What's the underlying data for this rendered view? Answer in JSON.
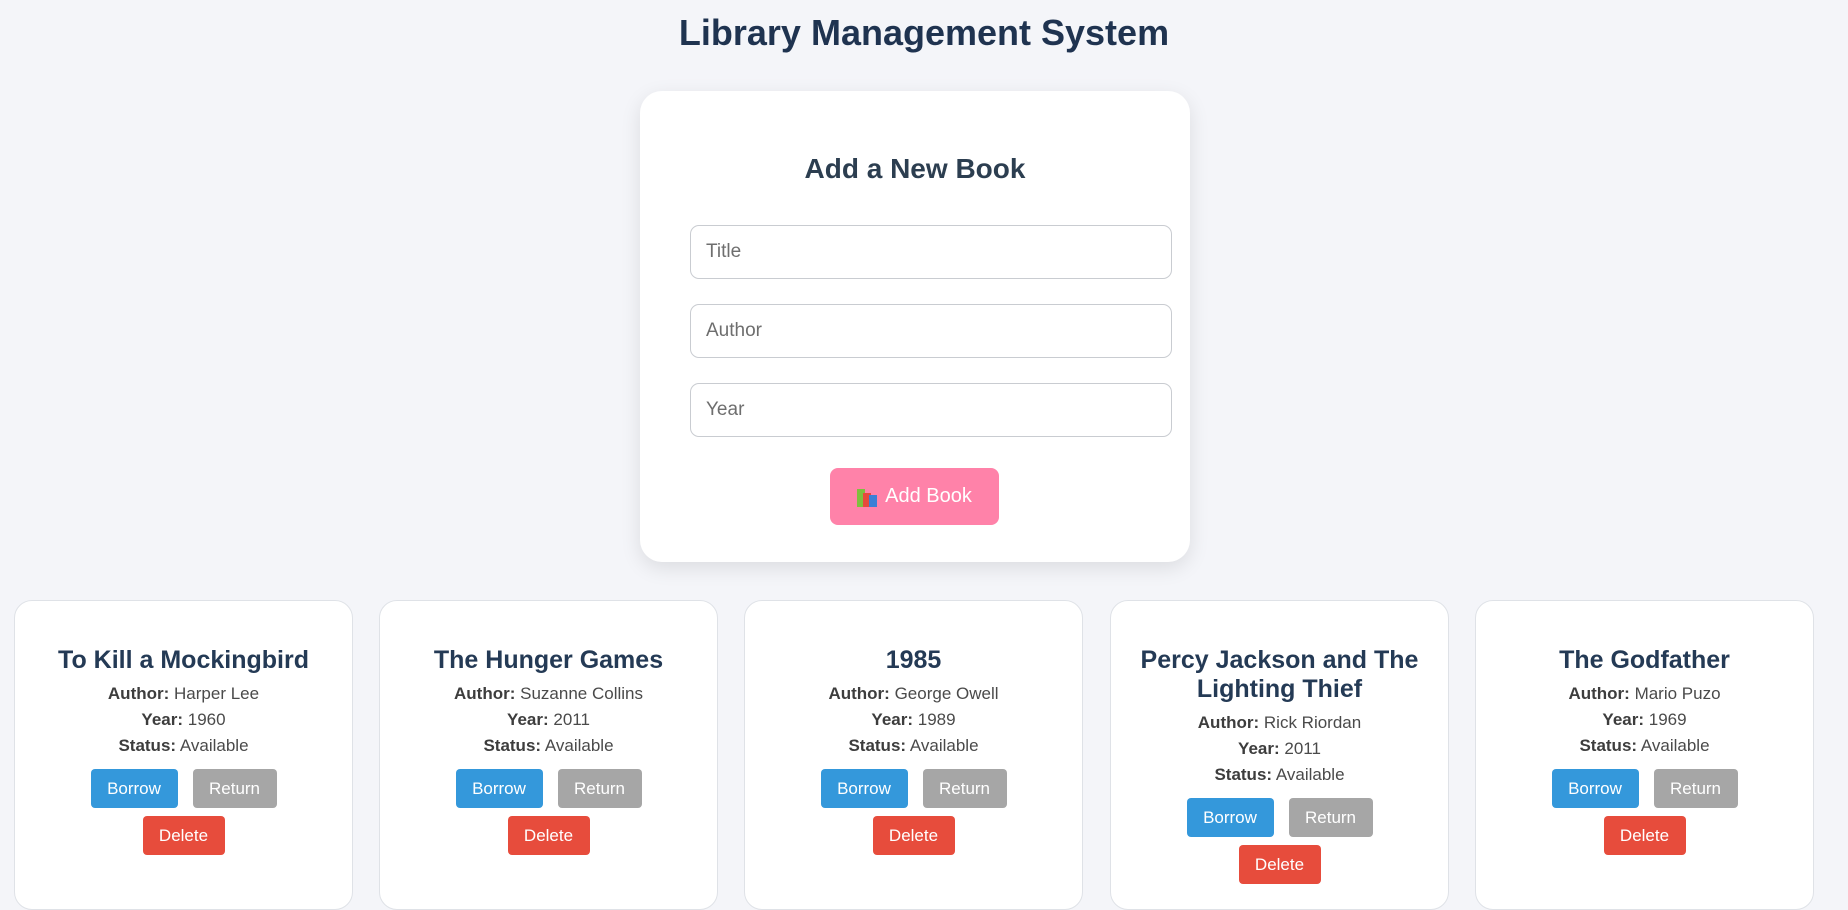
{
  "page": {
    "title": "Library Management System"
  },
  "form": {
    "title": "Add a New Book",
    "fields": {
      "title_placeholder": "Title",
      "author_placeholder": "Author",
      "year_placeholder": "Year"
    },
    "add_button": {
      "icon": "books-icon",
      "label": "Add Book"
    }
  },
  "labels": {
    "author": "Author:",
    "year": "Year:",
    "status": "Status:",
    "borrow": "Borrow",
    "return": "Return",
    "delete": "Delete"
  },
  "books": [
    {
      "title": "To Kill a Mockingbird",
      "author": "Harper Lee",
      "year": "1960",
      "status": "Available"
    },
    {
      "title": "The Hunger Games",
      "author": "Suzanne Collins",
      "year": "2011",
      "status": "Available"
    },
    {
      "title": "1985",
      "author": "George Owell",
      "year": "1989",
      "status": "Available"
    },
    {
      "title": "Percy Jackson and The Lighting Thief",
      "author": "Rick Riordan",
      "year": "2011",
      "status": "Available"
    },
    {
      "title": "The Godfather",
      "author": "Mario Puzo",
      "year": "1969",
      "status": "Available"
    }
  ],
  "colors": {
    "background": "#f4f5f9",
    "add_button": "#ff82a9",
    "borrow": "#3498db",
    "return": "#a6a6a6",
    "delete": "#e74c3c"
  }
}
